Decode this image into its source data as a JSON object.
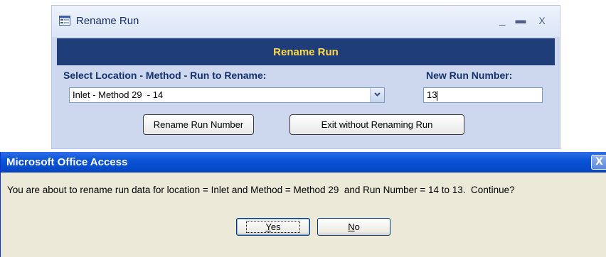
{
  "form": {
    "window_title": "Rename Run",
    "header_title": "Rename Run",
    "controls": {
      "minimize": "_",
      "maximize": "▬",
      "close": "X"
    },
    "location_label": "Select Location - Method - Run to Rename:",
    "location_value": "Inlet - Method 29  - 14",
    "run_number_label": "New Run Number:",
    "run_number_value": "13",
    "rename_button": "Rename Run Number",
    "exit_button": "Exit without Renaming Run"
  },
  "dialog": {
    "title": "Microsoft Office Access",
    "close": "X",
    "message": "You are about to rename run data for location = Inlet and Method = Method 29  and Run Number = 14 to 13.  Continue?",
    "yes_accel": "Y",
    "yes_rest": "es",
    "no_accel": "N",
    "no_rest": "o"
  },
  "colors": {
    "form_background": "#cdd8ef",
    "header_band": "#1f3d79",
    "header_text": "#ffd84a",
    "dialog_titlebar": "#0a55d6",
    "dialog_background": "#ece9d8"
  },
  "icons": {
    "form_icon": "form-icon",
    "dropdown": "chevron-down-icon"
  }
}
